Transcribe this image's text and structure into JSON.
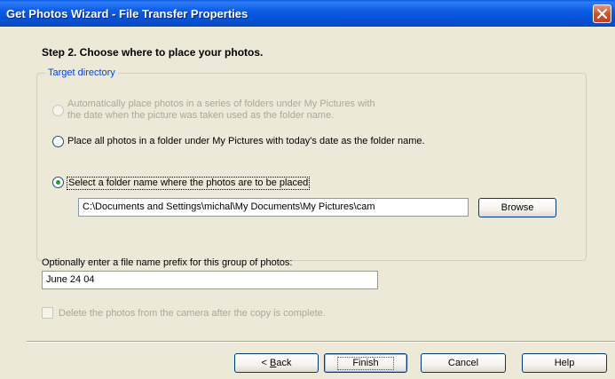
{
  "window": {
    "title": "Get Photos Wizard - File Transfer Properties"
  },
  "step": {
    "heading": "Step 2. Choose where to place your photos."
  },
  "target_directory": {
    "legend": "Target directory",
    "options": [
      {
        "line1": "Automatically place photos in a series of folders under My Pictures with",
        "line2": "the date when the picture was taken used as the folder name.",
        "selected": false,
        "enabled": false
      },
      {
        "label": "Place all photos in a folder under My Pictures with today's date as the folder name.",
        "selected": false,
        "enabled": true
      },
      {
        "label": "Select a folder name where the photos are to be placed",
        "selected": true,
        "enabled": true
      }
    ],
    "folder_path": "C:\\Documents and Settings\\michal\\My Documents\\My Pictures\\cam",
    "browse_label": "Browse"
  },
  "prefix": {
    "label": "Optionally enter a file name prefix for this group of photos:",
    "value": "June 24 04"
  },
  "delete_option": {
    "label": "Delete the photos from the camera after the copy is complete.",
    "checked": false,
    "enabled": false
  },
  "footer": {
    "back_label_prefix": "< ",
    "back_label_accel": "B",
    "back_label_rest": "ack",
    "finish_label": "Finish",
    "cancel_label": "Cancel",
    "help_label": "Help"
  },
  "colors": {
    "title_bar": "#0a59e0",
    "window_bg": "#ece9d8",
    "legend_text": "#0046d5",
    "disabled_text": "#aca899",
    "radio_dot": "#21a121"
  },
  "icons": {
    "close": "close-icon"
  }
}
